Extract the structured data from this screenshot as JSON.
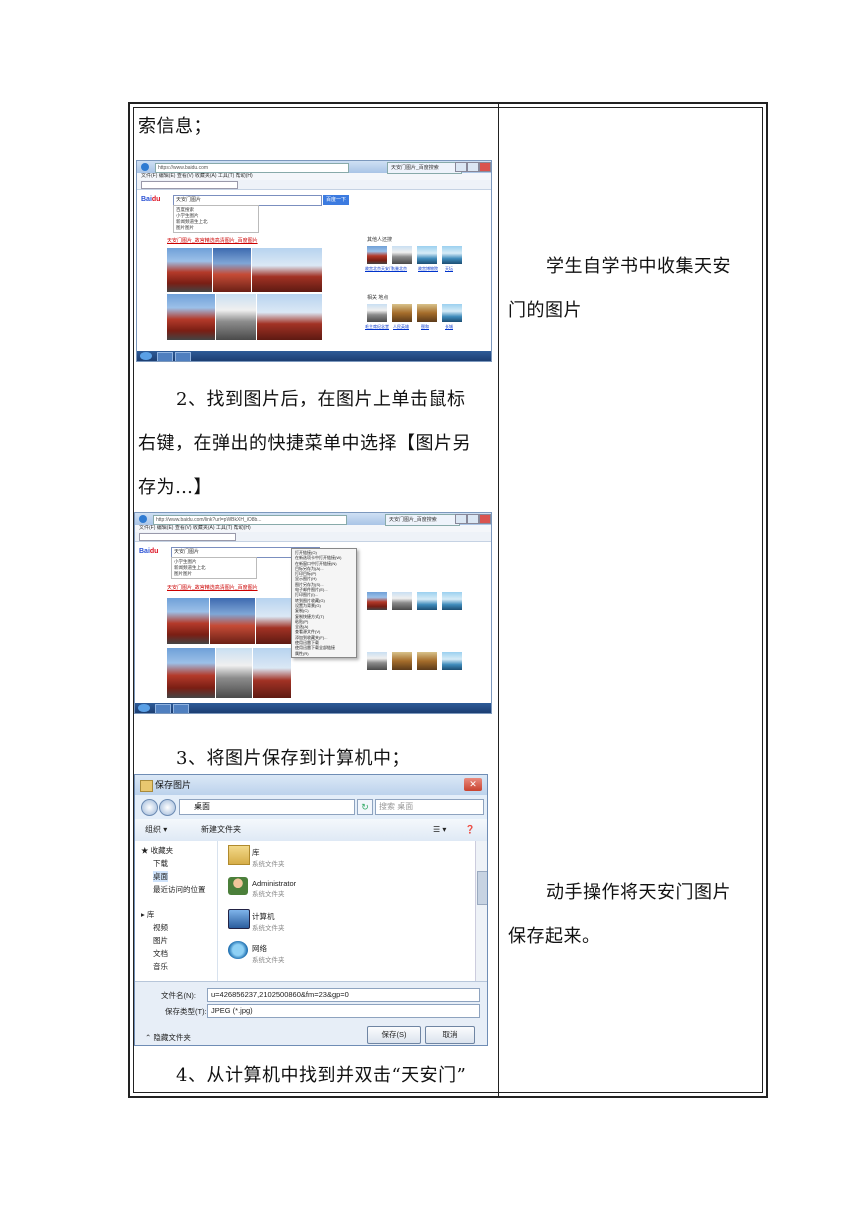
{
  "left_column": {
    "line_1": "索信息；",
    "step_2_line_1": "2、找到图片后，在图片上单击鼠标",
    "step_2_line_2": "右键，在弹出的快捷菜单中选择【图片另",
    "step_2_line_3": "存为…】",
    "step_3": "3、将图片保存到计算机中；",
    "step_4": "4、从计算机中找到并双击“天安门”"
  },
  "right_column": {
    "block_1_line_1": "学生自学书中收集天安",
    "block_1_line_2": "门的图片",
    "block_2_line_1": "动手操作将天安门图片",
    "block_2_line_2": "保存起来。"
  },
  "browser_1": {
    "address": "https://www.baidu.com",
    "tab_label": "天安门图片_百度搜索",
    "menu_bar": "文件(F)   编辑(E)   查看(V)   收藏夹(A)   工具(T)   帮助(H)",
    "search_text": "天安门图片",
    "search_button": "百度一下",
    "suggestions": [
      "百度搜索",
      "小学生图片",
      "新闻频道生上北",
      "图片图片"
    ],
    "result_title": "天安门图片_故宫精选高清图片_百度图片",
    "right_panel_head_1": "其他人还搜",
    "right_panel_head_2": "相关 地点",
    "captions_row_1": [
      "故宫北京天安门",
      "鸟巢北京",
      "故宫博物院",
      "天坛"
    ],
    "captions_row_2": [
      "毛主席纪念堂",
      "人民英雄",
      "颐和",
      "长城"
    ]
  },
  "browser_2": {
    "address": "http://www.baidu.com/link?url=pWBkXH_iO8b...",
    "tab_label": "天安门图片_百度搜索",
    "search_text": "天安门图片",
    "suggestions": [
      "小学生图片",
      "新闻频道生上北",
      "图片图片"
    ],
    "result_title": "天安门图片_故宫精选高清图片_百度图片",
    "context_menu": [
      "打开链接(O)",
      "在新选项卡中打开链接(W)",
      "在新窗口中打开链接(N)",
      "目标另存为(A)...",
      "打印目标(P)",
      "显示图片(H)",
      "图片另存为(S)...",
      "电子邮件图片(E)...",
      "打印图片(I)...",
      "转到图片收藏(G)",
      "设置为背景(G)",
      "复制(C)",
      "复制快捷方式(T)",
      "粘贴(P)",
      "全选(A)",
      "查看源文件(V)",
      "添加到收藏夹(F)...",
      "使用迅雷下载",
      "使用迅雷下载全部链接",
      "属性(R)"
    ]
  },
  "save_dialog": {
    "title": "保存图片",
    "path": "桌面",
    "search_placeholder": "搜索 桌面",
    "organize": "组织 ▾",
    "new_folder": "新建文件夹",
    "nav": [
      "收藏夹",
      "下载",
      "桌面",
      "最近访问的位置",
      "库",
      "视频",
      "图片",
      "文档",
      "音乐"
    ],
    "items": [
      {
        "name": "库",
        "sub": "系统文件夹"
      },
      {
        "name": "Administrator",
        "sub": "系统文件夹"
      },
      {
        "name": "计算机",
        "sub": "系统文件夹"
      },
      {
        "name": "网络",
        "sub": "系统文件夹"
      }
    ],
    "filename_label": "文件名(N):",
    "filename_value": "u=426856237,2102500860&fm=23&gp=0",
    "filetype_label": "保存类型(T):",
    "filetype_value": "JPEG (*.jpg)",
    "hide_folders": "隐藏文件夹",
    "save_button": "保存(S)",
    "cancel_button": "取消"
  }
}
